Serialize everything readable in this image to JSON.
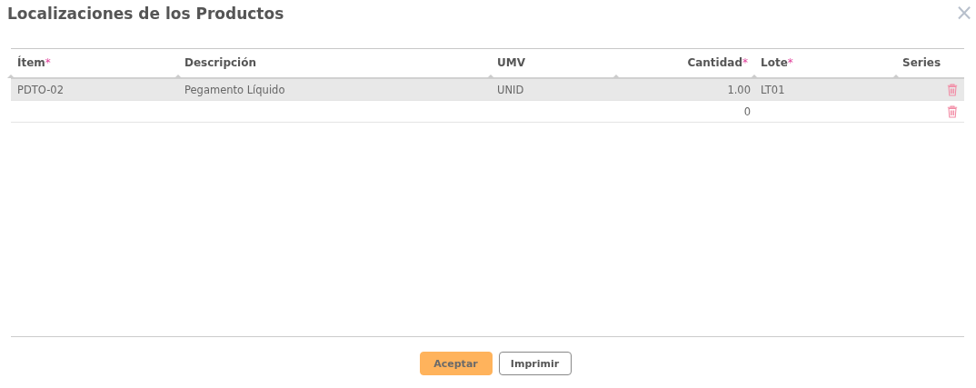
{
  "dialog": {
    "title": "Localizaciones de los Productos",
    "close": "×"
  },
  "table": {
    "columns": [
      {
        "label": "Ítem",
        "required_mark": "*"
      },
      {
        "label": "Descripción"
      },
      {
        "label": "UMV"
      },
      {
        "label": "Cantidad",
        "required_mark": "*"
      },
      {
        "label": "Lote",
        "required_mark": "*"
      },
      {
        "label": "Series"
      }
    ],
    "rows": [
      {
        "selected": true,
        "cells": [
          "PDTO-02",
          "Pegamento Líquido",
          "UNID",
          "1.00",
          "LT01",
          ""
        ]
      },
      {
        "selected": false,
        "cells": [
          "",
          "",
          "",
          "0",
          "",
          ""
        ]
      }
    ]
  },
  "buttons": [
    {
      "label": "Aceptar",
      "kind": "primary"
    },
    {
      "label": "Imprimir",
      "kind": "secondary"
    }
  ]
}
